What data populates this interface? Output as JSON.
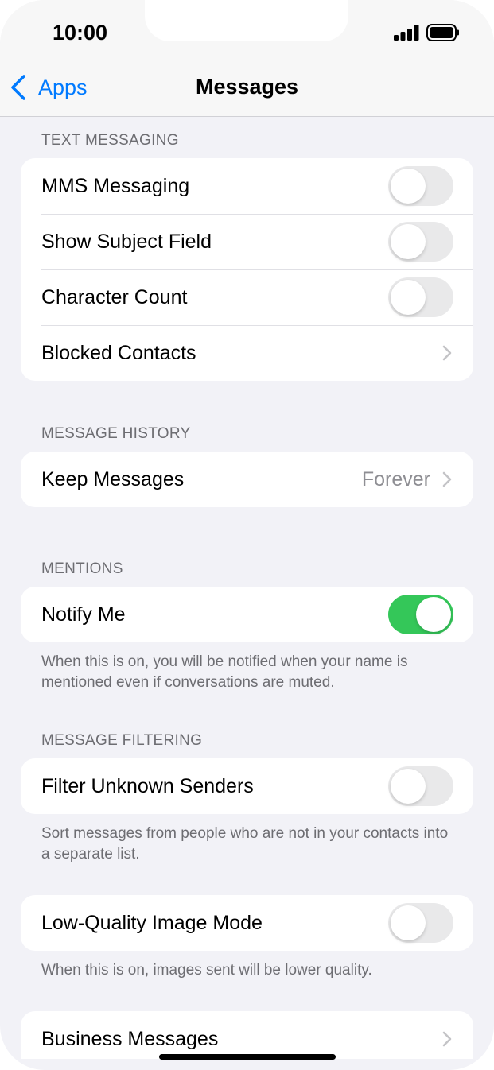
{
  "status_bar": {
    "time": "10:00"
  },
  "nav": {
    "back_label": "Apps",
    "title": "Messages"
  },
  "sections": {
    "text_messaging": {
      "header": "TEXT MESSAGING",
      "mms": "MMS Messaging",
      "subject": "Show Subject Field",
      "char_count": "Character Count",
      "blocked": "Blocked Contacts"
    },
    "message_history": {
      "header": "MESSAGE HISTORY",
      "keep": "Keep Messages",
      "keep_value": "Forever"
    },
    "mentions": {
      "header": "MENTIONS",
      "notify": "Notify Me",
      "footer": "When this is on, you will be notified when your name is mentioned even if conversations are muted."
    },
    "message_filtering": {
      "header": "MESSAGE FILTERING",
      "filter": "Filter Unknown Senders",
      "footer": "Sort messages from people who are not in your contacts into a separate list."
    },
    "low_quality": {
      "label": "Low-Quality Image Mode",
      "footer": "When this is on, images sent will be lower quality."
    },
    "business": {
      "label": "Business Messages"
    }
  },
  "toggles": {
    "mms": false,
    "subject": false,
    "char_count": false,
    "notify": true,
    "filter": false,
    "low_quality": false
  },
  "colors": {
    "accent": "#007aff",
    "toggle_on": "#34c759",
    "toggle_off": "#e9e9ea",
    "background": "#f2f2f7"
  },
  "icons": {
    "back": "chevron-left-icon",
    "disclosure": "chevron-right-icon",
    "signal": "cellular-signal-icon",
    "battery": "battery-icon"
  }
}
